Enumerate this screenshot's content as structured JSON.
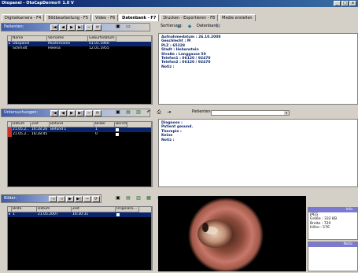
{
  "window": {
    "title": "Otopanel - OtoCapDermo® 1.0 V",
    "buttons": [
      "_",
      "□",
      "x"
    ]
  },
  "tabs": [
    {
      "label": "Digitalkamera - F4",
      "active": false
    },
    {
      "label": "Bildbearbeitung - F5",
      "active": false
    },
    {
      "label": "Video - F6",
      "active": false
    },
    {
      "label": "Datenbank - F7",
      "active": true
    },
    {
      "label": "Drucken - Exportieren - F8",
      "active": false
    },
    {
      "label": "Medie erstellen",
      "active": false
    }
  ],
  "patients": {
    "section_label": "Patienten:",
    "sort_label": "Sortierung:",
    "database_label": "Datenbank:",
    "columns": [
      "Name",
      "Vorname",
      "Geburtsdatum"
    ],
    "rows": [
      {
        "name": "Obspanel",
        "vorname": "Mustername",
        "geburt": "01.01.1960",
        "selected": true
      },
      {
        "name": "Schmidt",
        "vorname": "Helena",
        "geburt": "12.01.1955",
        "selected": false
      }
    ],
    "details": [
      "Aufnahmedatum : 26.10.2008",
      "Geschlecht : M",
      "PLZ : 65328",
      "Stadt : Hohenstein",
      "Straße : Langgasse 50",
      "Telefon1 : 06120 / 92470",
      "Telefon2 : 06120 / 92470",
      "Notiz :"
    ]
  },
  "examinations": {
    "section_label": "Untersuchungen:",
    "patient_label": "Patienten:",
    "columns": [
      "Datum",
      "Zeit",
      "Befund",
      "Bilder",
      "Bericht"
    ],
    "rows": [
      {
        "datum": "21.05.2...",
        "zeit": "16:28:26",
        "befund": "Befund 1",
        "bilder": "1",
        "selected": true
      },
      {
        "datum": "21.05.2...",
        "zeit": "16:28:45",
        "befund": "",
        "bilder": "0",
        "selected": false
      }
    ],
    "details": [
      "Diagnose :",
      "Patient gesund.",
      "",
      "Therapie :",
      "Keine",
      "",
      "Notiz :"
    ]
  },
  "images": {
    "section_label": "Bilder:",
    "columns": [
      "Bildn.",
      "Datum",
      "Zeit",
      "Original(L..."
    ],
    "rows": [
      {
        "bildn": "1",
        "datum": "21.05.2007",
        "zeit": "16:30:31",
        "selected": true
      }
    ],
    "info_title": "Info",
    "info_lines": [
      "JPEG",
      "Größe : 332 KB",
      "Breite : 720",
      "Höhe : 576"
    ],
    "notiz_title": "Notiz"
  },
  "colors": {
    "selection": "#0a246a",
    "info_text": "#0a246a",
    "panel_gradient_start": "#3c5aa8",
    "titlebar": "#0a246a"
  }
}
